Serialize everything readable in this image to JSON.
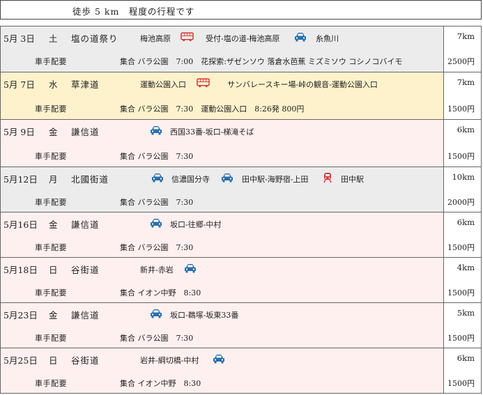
{
  "header": {
    "title": "徒歩 5 km　程度の行程です"
  },
  "colors": {
    "row_gray": "#ececec",
    "row_yellow": "#fef2cc",
    "row_pink": "#fef0ef",
    "car_blue": "#2a6fa8",
    "bus_red": "#d23a3a"
  },
  "rows": [
    {
      "date": "5月 3日",
      "dow": "土",
      "name": "塩の道祭り",
      "route1": "梅池高原",
      "route2": "受付-塩の道-梅池高原",
      "route3": "糸魚川",
      "organizer": "車手配要",
      "meeting": "集合 バラ公園　7:00　花探索:ザゼンソウ 落倉水芭蕉 ミズミソウ コシノコバイモ",
      "distance": "7km",
      "fee": "2500円",
      "icons": [
        "bus-icon",
        "car-icon"
      ]
    },
    {
      "date": "5月 7日",
      "dow": "水",
      "name": "草津道",
      "route1": "運動公園入口",
      "route2": "サンバレースキー場-峠の観音-運動公園入口",
      "organizer": "車手配要",
      "meeting": "集合 バラ公園　7:30　運動公園入口　8:26発 800円",
      "distance": "7km",
      "fee": "1500円",
      "icons": [
        "bus-icon"
      ]
    },
    {
      "date": "5月 9日",
      "dow": "金",
      "name": "謙信道",
      "route1": "西国33番-坂口-梯滝そば",
      "organizer": "車手配要",
      "meeting": "集合 バラ公園　7:30",
      "distance": "6km",
      "fee": "1500円",
      "icons": [
        "car-icon"
      ]
    },
    {
      "date": "5月12日",
      "dow": "月",
      "name": "北國街道",
      "route1": "信濃国分寺",
      "route2": "田中駅-海野宿-上田",
      "route3": "田中駅",
      "organizer": "車手配要",
      "meeting": "集合 バラ公園　7:30",
      "distance": "10km",
      "fee": "2000円",
      "icons": [
        "car-icon",
        "car-icon",
        "train-icon"
      ]
    },
    {
      "date": "5月16日",
      "dow": "金",
      "name": "謙信道",
      "route1": "坂口-往郷-中村",
      "organizer": "車手配要",
      "meeting": "集合 バラ公園　7:30",
      "distance": "6km",
      "fee": "1500円",
      "icons": [
        "car-icon"
      ]
    },
    {
      "date": "5月18日",
      "dow": "日",
      "name": "谷街道",
      "route1": "新井-赤岩",
      "organizer": "車手配要",
      "meeting": "集合 イオン中野　8:30",
      "distance": "4km",
      "fee": "1500円",
      "icons": [
        "car-icon"
      ]
    },
    {
      "date": "5月23日",
      "dow": "金",
      "name": "謙信道",
      "route1": "坂口-鵜塚-坂東33番",
      "organizer": "車手配要",
      "meeting": "集合 バラ公園　7:30",
      "distance": "5km",
      "fee": "1500円",
      "icons": [
        "car-icon"
      ]
    },
    {
      "date": "5月25日",
      "dow": "日",
      "name": "谷街道",
      "route1": "岩井-綱切橋-中村",
      "organizer": "車手配要",
      "meeting": "集合 イオン中野　8:30",
      "distance": "6km",
      "fee": "1500円",
      "icons": [
        "car-icon"
      ]
    }
  ]
}
